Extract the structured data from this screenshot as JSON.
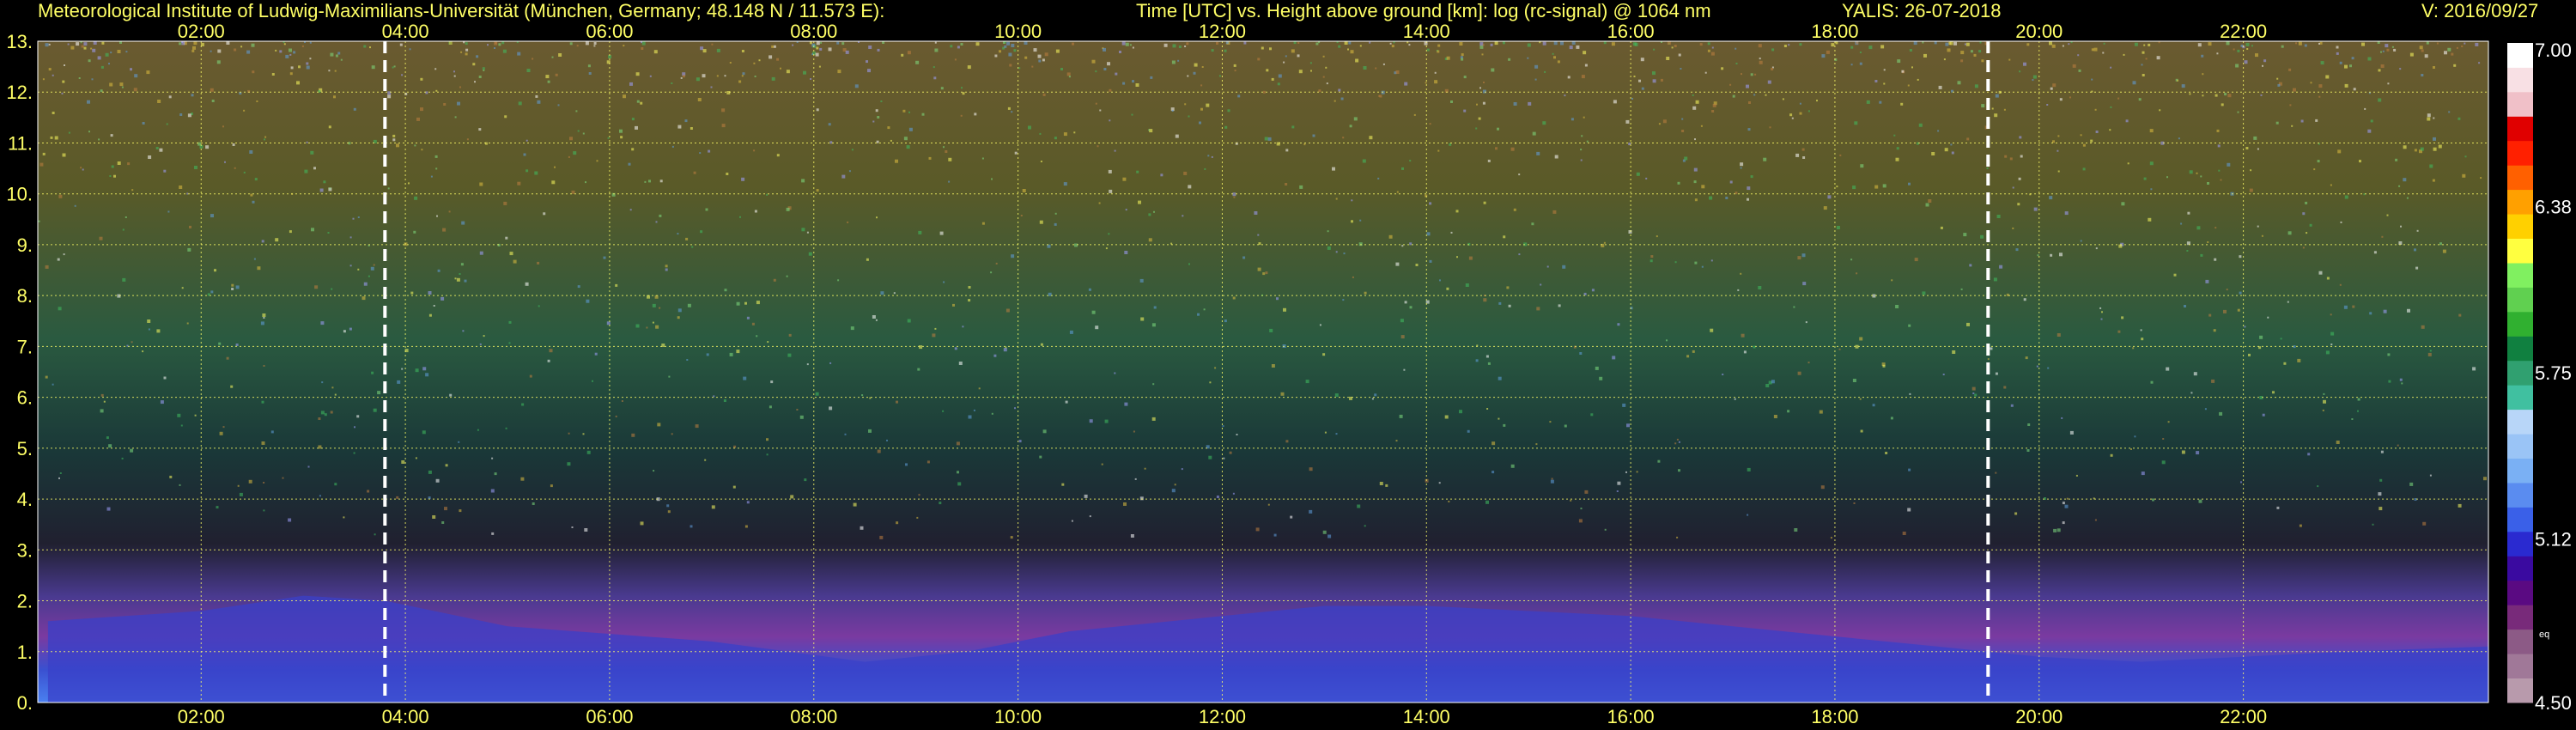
{
  "header": {
    "institute": "Meteorological Institute of Ludwig-Maximilians-Universität (München, Germany; 48.148 N / 11.573 E):",
    "description": "Time [UTC] vs. Height above ground [km]: log (rc-signal) @ 1064 nm",
    "instrument_date": "YALIS: 26-07-2018",
    "version": "V: 2016/09/27"
  },
  "chart_data": {
    "type": "heatmap",
    "title": "Time [UTC] vs. Height above ground [km]: log (rc-signal) @ 1064 nm",
    "xlabel": "",
    "ylabel": "",
    "x_range": [
      0.4,
      24.4
    ],
    "xlim": [
      0.4,
      24.4
    ],
    "ylim": [
      0,
      13
    ],
    "x_ticks": [
      {
        "value": 2,
        "label": "02:00"
      },
      {
        "value": 4,
        "label": "04:00"
      },
      {
        "value": 6,
        "label": "06:00"
      },
      {
        "value": 8,
        "label": "08:00"
      },
      {
        "value": 10,
        "label": "10:00"
      },
      {
        "value": 12,
        "label": "12:00"
      },
      {
        "value": 14,
        "label": "14:00"
      },
      {
        "value": 16,
        "label": "16:00"
      },
      {
        "value": 18,
        "label": "18:00"
      },
      {
        "value": 20,
        "label": "20:00"
      },
      {
        "value": 22,
        "label": "22:00"
      }
    ],
    "y_ticks": [
      {
        "value": 0,
        "label": "0."
      },
      {
        "value": 1,
        "label": "1."
      },
      {
        "value": 2,
        "label": "2."
      },
      {
        "value": 3,
        "label": "3."
      },
      {
        "value": 4,
        "label": "4."
      },
      {
        "value": 5,
        "label": "5."
      },
      {
        "value": 6,
        "label": "6."
      },
      {
        "value": 7,
        "label": "7."
      },
      {
        "value": 8,
        "label": "8."
      },
      {
        "value": 9,
        "label": "9."
      },
      {
        "value": 10,
        "label": "10."
      },
      {
        "value": 11,
        "label": "11."
      },
      {
        "value": 12,
        "label": "12."
      },
      {
        "value": 13,
        "label": "13."
      }
    ],
    "grid": true,
    "vertical_markers_time": [
      3.8,
      19.5
    ],
    "boundary_layer_top_km": [
      [
        0.5,
        1.6
      ],
      [
        2,
        1.8
      ],
      [
        3,
        2.1
      ],
      [
        3.8,
        2.0
      ],
      [
        5,
        1.5
      ],
      [
        7,
        1.2
      ],
      [
        8.5,
        0.8
      ],
      [
        9.5,
        1.0
      ],
      [
        10.5,
        1.4
      ],
      [
        12,
        1.7
      ],
      [
        13,
        1.9
      ],
      [
        14,
        1.9
      ],
      [
        15,
        1.8
      ],
      [
        16,
        1.7
      ],
      [
        17,
        1.5
      ],
      [
        18,
        1.3
      ],
      [
        19,
        1.1
      ],
      [
        20,
        0.9
      ],
      [
        21,
        0.8
      ],
      [
        22,
        0.9
      ],
      [
        23,
        1.0
      ],
      [
        24.4,
        1.1
      ]
    ],
    "colorbar": {
      "min": 4.5,
      "max": 7.0,
      "labels": [
        {
          "value": 7.0,
          "label": "7.00"
        },
        {
          "value": 6.38,
          "label": "6.38"
        },
        {
          "value": 5.75,
          "label": "5.75"
        },
        {
          "value": 5.12,
          "label": "5.12"
        },
        {
          "value": 4.5,
          "label": "4.50"
        }
      ],
      "eq_label": "eq",
      "colors": [
        "#b89aac",
        "#a07898",
        "#8c5a86",
        "#782a7a",
        "#5a0a82",
        "#3a0aa0",
        "#2a2ad0",
        "#3a60e8",
        "#5a8cf0",
        "#7ab0f4",
        "#9ac4f6",
        "#b8d6f8",
        "#40c0a0",
        "#30a070",
        "#108040",
        "#30b030",
        "#60d050",
        "#80f060",
        "#ffff40",
        "#ffd000",
        "#ffa000",
        "#ff6000",
        "#ff2000",
        "#e00000",
        "#f0c0c8",
        "#f8e0e4",
        "#ffffff"
      ]
    }
  }
}
